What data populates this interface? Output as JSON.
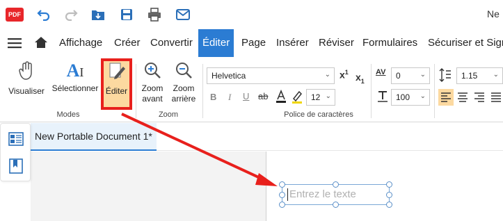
{
  "app": {
    "logo_text": "PDF",
    "title_fragment": "Ne"
  },
  "menu": {
    "items": [
      "Affichage",
      "Créer",
      "Convertir",
      "Éditer",
      "Page",
      "Insérer",
      "Réviser",
      "Formulaires",
      "Sécuriser et Sign"
    ],
    "active": "Éditer"
  },
  "ribbon": {
    "modes": {
      "visualiser": "Visualiser",
      "selectionner": "Sélectionner",
      "editer": "Éditer",
      "group_label": "Modes"
    },
    "zoom": {
      "zoom_avant_1": "Zoom",
      "zoom_avant_2": "avant",
      "zoom_arriere_1": "Zoom",
      "zoom_arriere_2": "arrière",
      "group_label": "Zoom"
    },
    "font": {
      "family": "Helvetica",
      "size": "12",
      "group_label": "Police de caractères"
    },
    "spacing": {
      "char_spacing": "0",
      "scale": "100",
      "line_spacing": "1.15"
    }
  },
  "document": {
    "tab_title": "New Portable Document 1*",
    "textbox_placeholder": "Entrez le texte"
  },
  "colors": {
    "accent": "#2b7cd3",
    "annotation": "#e8201c",
    "pdf_red": "#e8262a"
  }
}
